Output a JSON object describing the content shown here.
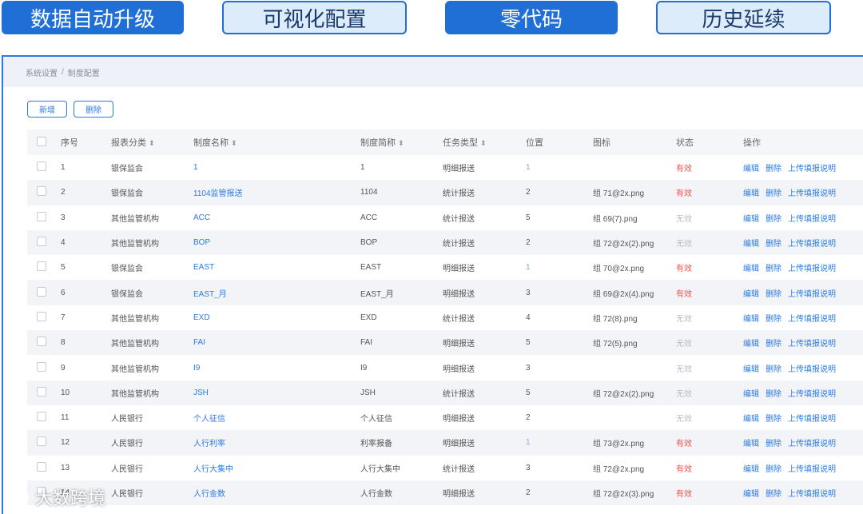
{
  "banners": [
    "数据自动升级",
    "可视化配置",
    "零代码",
    "历史延续"
  ],
  "breadcrumb": {
    "root": "系统设置",
    "separator": "/",
    "current": "制度配置"
  },
  "toolbar": {
    "add": "新增",
    "delete": "删除"
  },
  "columns": [
    "序号",
    "报表分类",
    "制度名称",
    "制度简称",
    "任务类型",
    "位置",
    "图标",
    "状态",
    "操作"
  ],
  "rows": [
    {
      "idx": "1",
      "cat": "银保监会",
      "name": "1",
      "abbr": "1",
      "type": "明细报送",
      "pos": "1",
      "icon": "",
      "status": "有效",
      "active": true
    },
    {
      "idx": "2",
      "cat": "银保监会",
      "name": "1104监管报送",
      "abbr": "1104",
      "type": "统计报送",
      "pos": "2",
      "icon": "组 71@2x.png",
      "status": "有效",
      "active": true
    },
    {
      "idx": "3",
      "cat": "其他监管机构",
      "name": "ACC",
      "abbr": "ACC",
      "type": "统计报送",
      "pos": "5",
      "icon": "组 69(7).png",
      "status": "无效",
      "active": false
    },
    {
      "idx": "4",
      "cat": "其他监管机构",
      "name": "BOP",
      "abbr": "BOP",
      "type": "统计报送",
      "pos": "2",
      "icon": "组 72@2x(2).png",
      "status": "无效",
      "active": false
    },
    {
      "idx": "5",
      "cat": "银保监会",
      "name": "EAST",
      "abbr": "EAST",
      "type": "明细报送",
      "pos": "1",
      "icon": "组 70@2x.png",
      "status": "有效",
      "active": true
    },
    {
      "idx": "6",
      "cat": "银保监会",
      "name": "EAST_月",
      "abbr": "EAST_月",
      "type": "明细报送",
      "pos": "3",
      "icon": "组 69@2x(4).png",
      "status": "有效",
      "active": true
    },
    {
      "idx": "7",
      "cat": "其他监管机构",
      "name": "EXD",
      "abbr": "EXD",
      "type": "统计报送",
      "pos": "4",
      "icon": "组 72(8).png",
      "status": "无效",
      "active": false
    },
    {
      "idx": "8",
      "cat": "其他监管机构",
      "name": "FAI",
      "abbr": "FAI",
      "type": "明细报送",
      "pos": "5",
      "icon": "组 72(5).png",
      "status": "无效",
      "active": false
    },
    {
      "idx": "9",
      "cat": "其他监管机构",
      "name": "I9",
      "abbr": "I9",
      "type": "明细报送",
      "pos": "3",
      "icon": "",
      "status": "无效",
      "active": false
    },
    {
      "idx": "10",
      "cat": "其他监管机构",
      "name": "JSH",
      "abbr": "JSH",
      "type": "统计报送",
      "pos": "5",
      "icon": "组 72@2x(2).png",
      "status": "无效",
      "active": false
    },
    {
      "idx": "11",
      "cat": "人民银行",
      "name": "个人征信",
      "abbr": "个人征信",
      "type": "明细报送",
      "pos": "2",
      "icon": "",
      "status": "无效",
      "active": false
    },
    {
      "idx": "12",
      "cat": "人民银行",
      "name": "人行利率",
      "abbr": "利率报备",
      "type": "明细报送",
      "pos": "1",
      "icon": "组 73@2x.png",
      "status": "有效",
      "active": true
    },
    {
      "idx": "13",
      "cat": "人民银行",
      "name": "人行大集中",
      "abbr": "人行大集中",
      "type": "统计报送",
      "pos": "3",
      "icon": "组 72@2x.png",
      "status": "有效",
      "active": true
    },
    {
      "idx": "14",
      "cat": "人民银行",
      "name": "人行金数",
      "abbr": "人行金数",
      "type": "明细报送",
      "pos": "2",
      "icon": "组 72@2x(3).png",
      "status": "有效",
      "active": true
    }
  ],
  "row_actions": {
    "edit": "编辑",
    "delete": "删除",
    "upload": "上传填报说明"
  },
  "watermark": "大数跨境"
}
